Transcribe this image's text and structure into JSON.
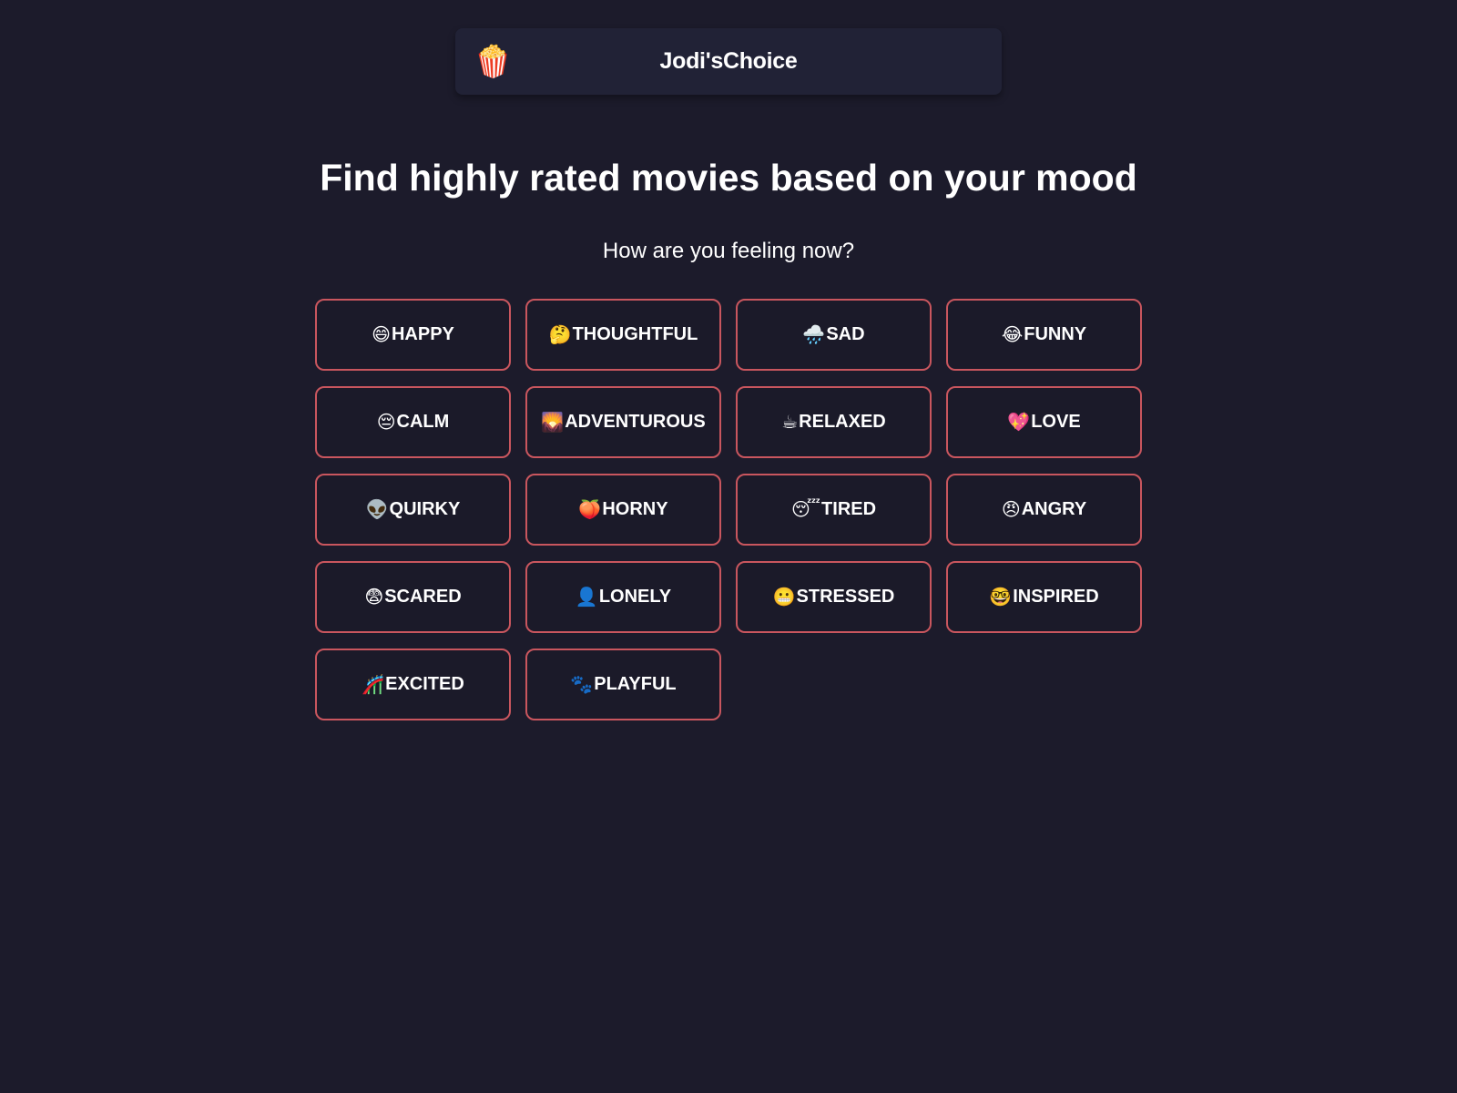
{
  "header": {
    "logo_icon": "🍿",
    "brand": "Jodi'sChoice"
  },
  "main": {
    "title": "Find highly rated movies based on your mood",
    "subtitle": "How are you feeling now?"
  },
  "moods": [
    {
      "emoji": "😄",
      "icon": "grinning-face-icon",
      "label": "HAPPY"
    },
    {
      "emoji": "🤔",
      "icon": "thinking-face-icon",
      "label": "THOUGHTFUL"
    },
    {
      "emoji": "🌧️",
      "icon": "rain-cloud-icon",
      "label": "SAD"
    },
    {
      "emoji": "😂",
      "icon": "tears-of-joy-icon",
      "label": "FUNNY"
    },
    {
      "emoji": "😔",
      "icon": "pensive-face-icon",
      "label": "CALM"
    },
    {
      "emoji": "🌄",
      "icon": "sunrise-mountains-icon",
      "label": "ADVENTUROUS"
    },
    {
      "emoji": "☕",
      "icon": "coffee-icon",
      "label": "RELAXED"
    },
    {
      "emoji": "💖",
      "icon": "sparkling-heart-icon",
      "label": "LOVE"
    },
    {
      "emoji": "👽",
      "icon": "alien-icon",
      "label": "QUIRKY"
    },
    {
      "emoji": "🍑",
      "icon": "peach-icon",
      "label": "HORNY"
    },
    {
      "emoji": "😴",
      "icon": "sleeping-face-icon",
      "label": "TIRED"
    },
    {
      "emoji": "😠",
      "icon": "angry-face-icon",
      "label": "ANGRY"
    },
    {
      "emoji": "😨",
      "icon": "fearful-face-icon",
      "label": "SCARED"
    },
    {
      "emoji": "👤",
      "icon": "silhouette-icon",
      "label": "LONELY"
    },
    {
      "emoji": "😬",
      "icon": "grimacing-face-icon",
      "label": "STRESSED"
    },
    {
      "emoji": "🤓",
      "icon": "nerd-face-icon",
      "label": "INSPIRED"
    },
    {
      "emoji": "🎢",
      "icon": "roller-coaster-icon",
      "label": "EXCITED"
    },
    {
      "emoji": "🐾",
      "icon": "paw-prints-icon",
      "label": "PLAYFUL"
    }
  ],
  "colors": {
    "background": "#1c1b2b",
    "header_bg": "#212236",
    "button_border": "#c9565e",
    "text": "#ffffff"
  }
}
